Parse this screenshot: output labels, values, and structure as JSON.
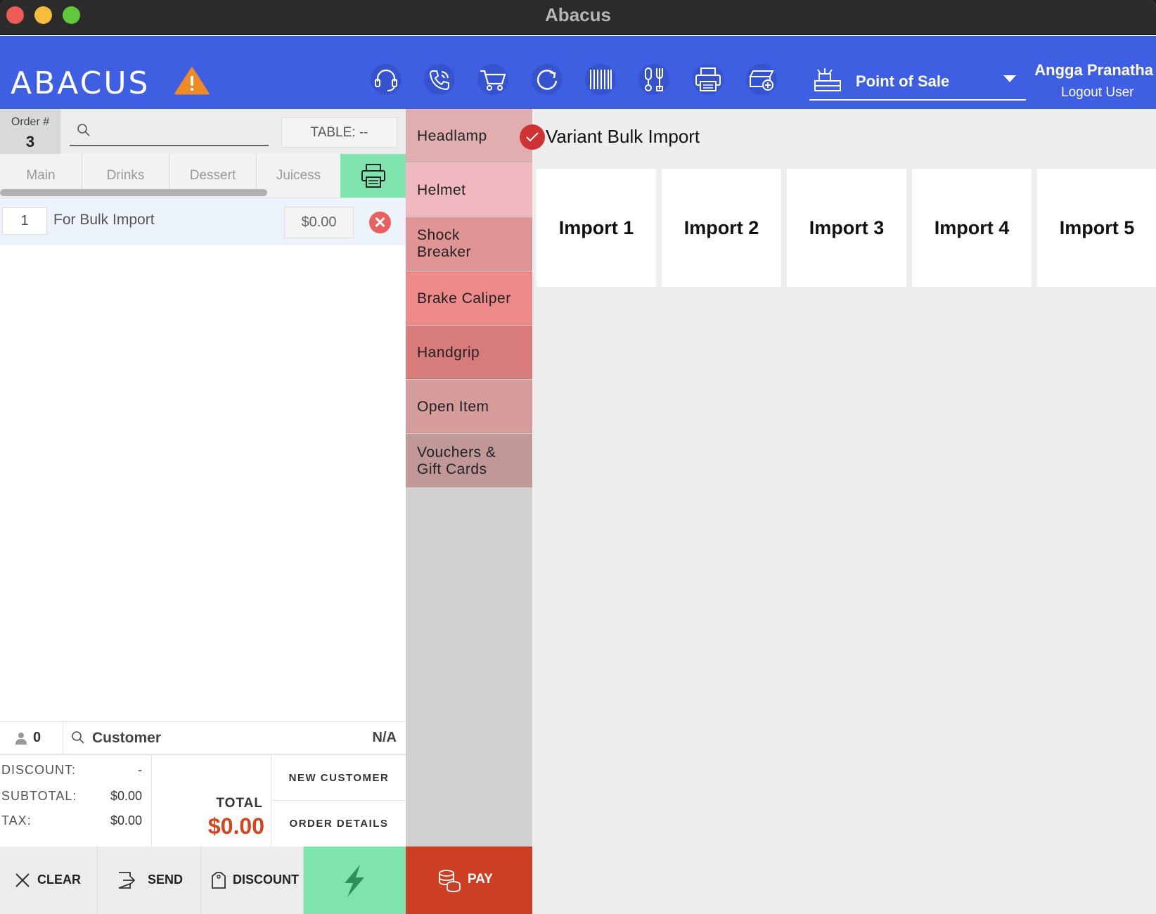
{
  "window": {
    "title": "Abacus"
  },
  "header": {
    "logo": "ABACUS",
    "icons": [
      "warning-icon",
      "headset-icon",
      "phone-icon",
      "cart-icon",
      "refresh-icon",
      "barcode-icon",
      "kitchen-icon",
      "printer-icon",
      "drawer-icon"
    ],
    "module": "Point of Sale",
    "user_name": "Angga Pranatha",
    "logout": "Logout User"
  },
  "order": {
    "label": "Order #",
    "number": "3",
    "search_placeholder": "",
    "table": "TABLE: --",
    "tabs": [
      "Main",
      "Drinks",
      "Dessert",
      "Juicess"
    ],
    "items": [
      {
        "qty": "1",
        "name": "For Bulk Import",
        "price": "$0.00"
      }
    ],
    "pax": "0",
    "customer_label": "Customer",
    "customer_value": "N/A",
    "discount_label": "DISCOUNT:",
    "discount_value": "-",
    "subtotal_label": "SUBTOTAL:",
    "subtotal_value": "$0.00",
    "tax_label": "TAX:",
    "tax_value": "$0.00",
    "total_label": "TOTAL",
    "total_value": "$0.00",
    "new_customer": "NEW CUSTOMER",
    "order_details": "ORDER DETAILS",
    "clear": "CLEAR",
    "send": "SEND",
    "discount": "DISCOUNT",
    "pay": "PAY"
  },
  "categories": [
    {
      "label": "Headlamp",
      "color": "#e0aeae"
    },
    {
      "label": "Helmet",
      "color": "#f0b9bf"
    },
    {
      "label": "Shock Breaker",
      "color": "#e19494"
    },
    {
      "label": "Brake Caliper",
      "color": "#ee8a8a"
    },
    {
      "label": "Handgrip",
      "color": "#d87b7b"
    },
    {
      "label": "Open Item",
      "color": "#d69c9c"
    },
    {
      "label": "Vouchers & Gift Cards",
      "color": "#c19898"
    }
  ],
  "products": {
    "heading": "Variant Bulk Import",
    "tiles": [
      "Import 1",
      "Import 2",
      "Import 3",
      "Import 4",
      "Import 5"
    ]
  },
  "colors": {
    "header": "#3f5fe3",
    "accent_green": "#7fe3ae",
    "pay_red": "#cd3f22",
    "total_red": "#d2451f"
  }
}
